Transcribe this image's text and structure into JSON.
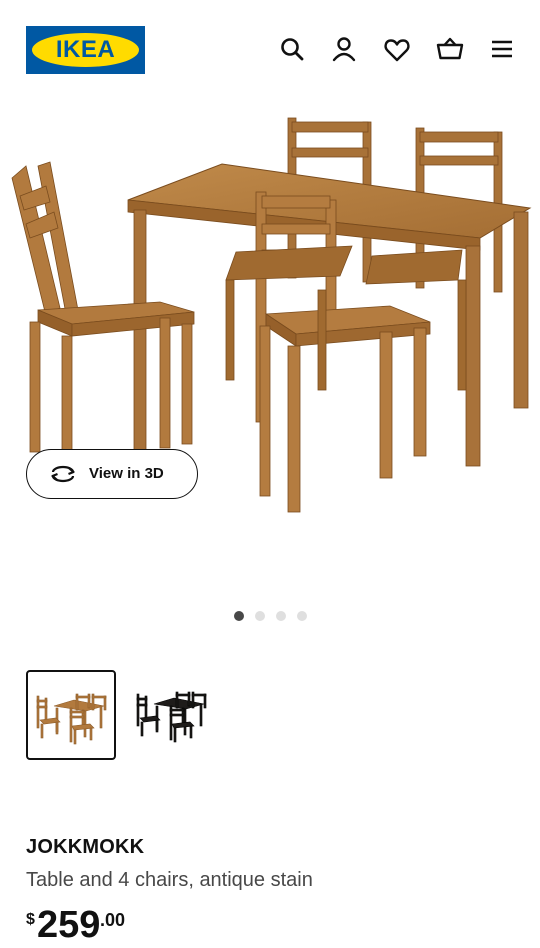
{
  "brand": {
    "logo_text": "IKEA",
    "blue": "#0058a3",
    "yellow": "#ffdb00"
  },
  "header_icons": [
    "search-icon",
    "account-icon",
    "heart-icon",
    "cart-icon",
    "menu-icon"
  ],
  "gallery": {
    "view3d_label": "View in 3D",
    "slides_total": 4,
    "active_slide": 1
  },
  "thumbnails": [
    {
      "variant": "antique stain",
      "selected": true
    },
    {
      "variant": "black-brown",
      "selected": false
    }
  ],
  "product": {
    "name": "JOKKMOKK",
    "description": "Table and 4 chairs, antique stain",
    "price": {
      "currency": "$",
      "integer": "259",
      "decimal": ".00"
    }
  },
  "colors": {
    "wood": "#b07a3e",
    "wood_dark": "#8c5a28",
    "text": "#111111",
    "muted": "#484848"
  }
}
